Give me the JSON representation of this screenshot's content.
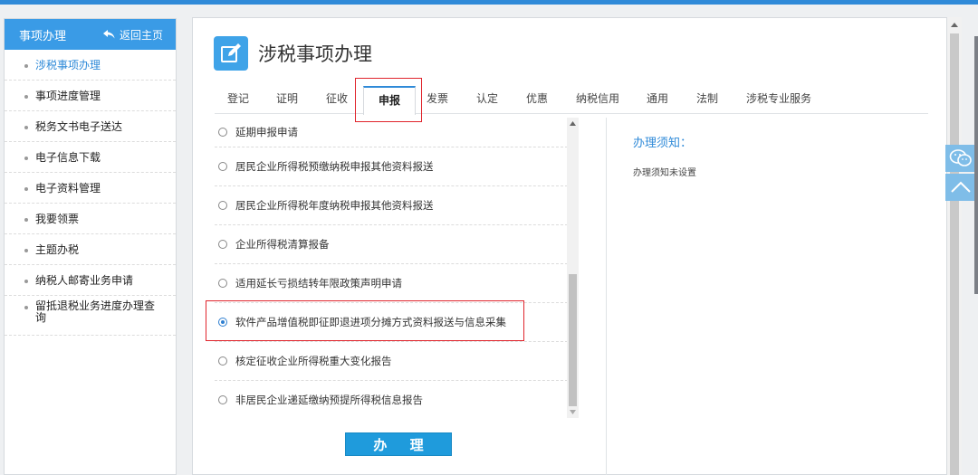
{
  "sidebar": {
    "title": "事项办理",
    "back_label": "返回主页",
    "items": [
      {
        "label": "涉税事项办理"
      },
      {
        "label": "事项进度管理"
      },
      {
        "label": "税务文书电子送达"
      },
      {
        "label": "电子信息下载"
      },
      {
        "label": "电子资料管理"
      },
      {
        "label": "我要领票"
      },
      {
        "label": "主题办税"
      },
      {
        "label": "纳税人邮寄业务申请"
      },
      {
        "label": "留抵退税业务进度办理查询"
      }
    ]
  },
  "main": {
    "title": "涉税事项办理",
    "tabs": [
      {
        "label": "登记"
      },
      {
        "label": "证明"
      },
      {
        "label": "征收"
      },
      {
        "label": "申报"
      },
      {
        "label": "发票"
      },
      {
        "label": "认定"
      },
      {
        "label": "优惠"
      },
      {
        "label": "纳税信用"
      },
      {
        "label": "通用"
      },
      {
        "label": "法制"
      },
      {
        "label": "涉税专业服务"
      }
    ],
    "active_tab": "申报",
    "items": [
      {
        "label": "延期申报申请",
        "checked": false
      },
      {
        "label": "居民企业所得税预缴纳税申报其他资料报送",
        "checked": false
      },
      {
        "label": "居民企业所得税年度纳税申报其他资料报送",
        "checked": false
      },
      {
        "label": "企业所得税清算报备",
        "checked": false
      },
      {
        "label": "适用延长亏损结转年限政策声明申请",
        "checked": false
      },
      {
        "label": "软件产品增值税即征即退进项分摊方式资料报送与信息采集",
        "checked": true
      },
      {
        "label": "核定征收企业所得税重大变化报告",
        "checked": false
      },
      {
        "label": "非居民企业递延缴纳预提所得税信息报告",
        "checked": false
      }
    ],
    "submit_label": "办 理",
    "notes": {
      "title": "办理须知：",
      "body": "办理须知未设置"
    }
  },
  "icons": {
    "title_icon": "edit-icon",
    "back_icon": "back-arrow-icon",
    "wechat_icon": "wechat-icon",
    "top_icon": "chevron-up-icon"
  },
  "colors": {
    "accent": "#2f8ad8",
    "header": "#3a9be6",
    "button": "#1f9bdc",
    "highlight_box": "#e0242c"
  }
}
